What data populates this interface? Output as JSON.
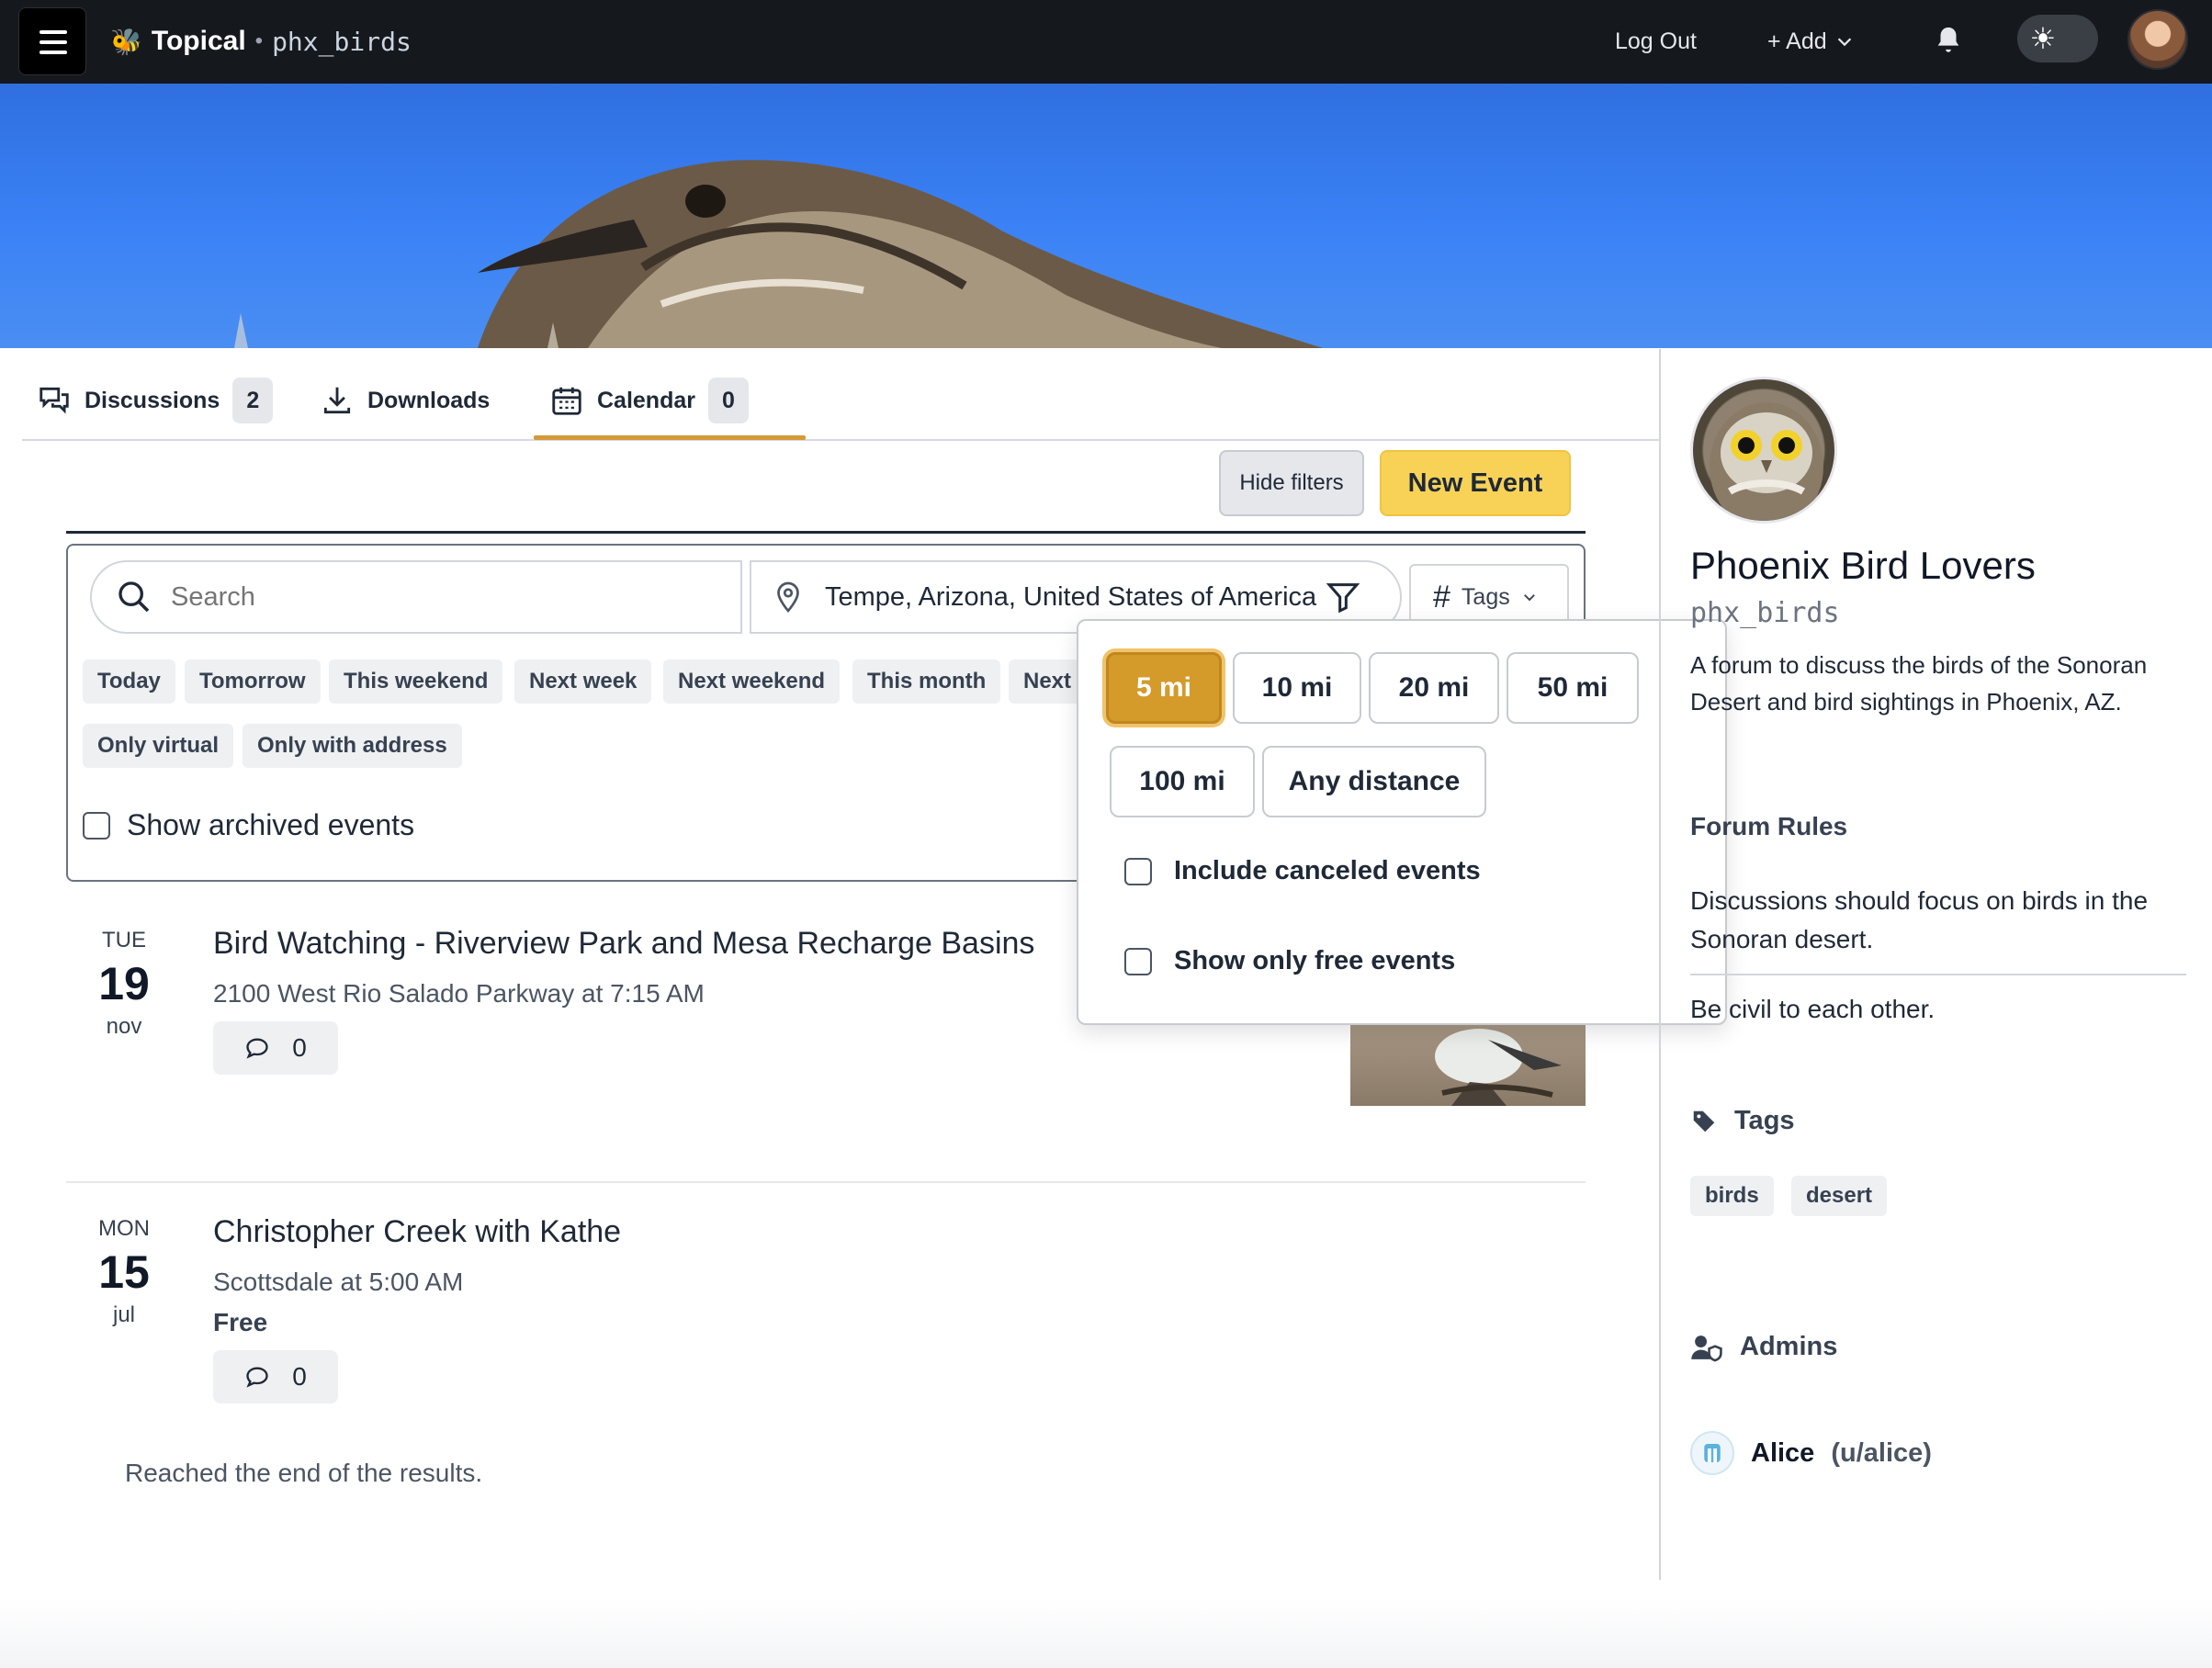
{
  "header": {
    "app_name": "Topical",
    "separator": "•",
    "forum_handle": "phx_birds",
    "logout_label": "Log Out",
    "add_label": "+ Add"
  },
  "tabs": [
    {
      "label": "Discussions",
      "count": "2"
    },
    {
      "label": "Downloads"
    },
    {
      "label": "Calendar",
      "count": "0"
    }
  ],
  "actions": {
    "hide_filters_label": "Hide filters",
    "new_event_label": "New Event"
  },
  "filters": {
    "search_placeholder": "Search",
    "location_value": "Tempe, Arizona, United States of America",
    "tags_label": "Tags",
    "date_chips": [
      "Today",
      "Tomorrow",
      "This weekend",
      "Next week",
      "Next weekend",
      "This month",
      "Next"
    ],
    "type_chips": [
      "Only virtual",
      "Only with address"
    ],
    "archived_label": "Show archived events"
  },
  "distance_popup": {
    "options": [
      "5 mi",
      "10 mi",
      "20 mi",
      "50 mi",
      "100 mi",
      "Any distance"
    ],
    "selected": "5 mi",
    "include_canceled_label": "Include canceled events",
    "only_free_label": "Show only free events"
  },
  "events": [
    {
      "dow": "TUE",
      "day": "19",
      "month": "nov",
      "title": "Bird Watching - Riverview Park and Mesa Recharge Basins",
      "subtitle": "2100 West Rio Salado Parkway at 7:15 AM",
      "comments": "0"
    },
    {
      "dow": "MON",
      "day": "15",
      "month": "jul",
      "title": "Christopher Creek with Kathe",
      "subtitle": "Scottsdale at 5:00 AM",
      "price": "Free",
      "comments": "0"
    }
  ],
  "end_message": "Reached the end of the results.",
  "sidebar": {
    "title": "Phoenix Bird Lovers",
    "handle": "phx_birds",
    "description": "A forum to discuss the birds of the Sonoran Desert and bird sightings in Phoenix, AZ.",
    "rules_heading": "Forum Rules",
    "rules": [
      "Discussions should focus on birds in the Sonoran desert.",
      "Be civil to each other."
    ],
    "tags_heading": "Tags",
    "tags": [
      "birds",
      "desert"
    ],
    "admins_heading": "Admins",
    "admin_name": "Alice",
    "admin_username": "(u/alice)"
  },
  "colors": {
    "accent": "#d49a2a",
    "new_event_bg": "#f8d257",
    "topbar_bg": "#15181c",
    "banner_sky": "#3b82f6"
  }
}
